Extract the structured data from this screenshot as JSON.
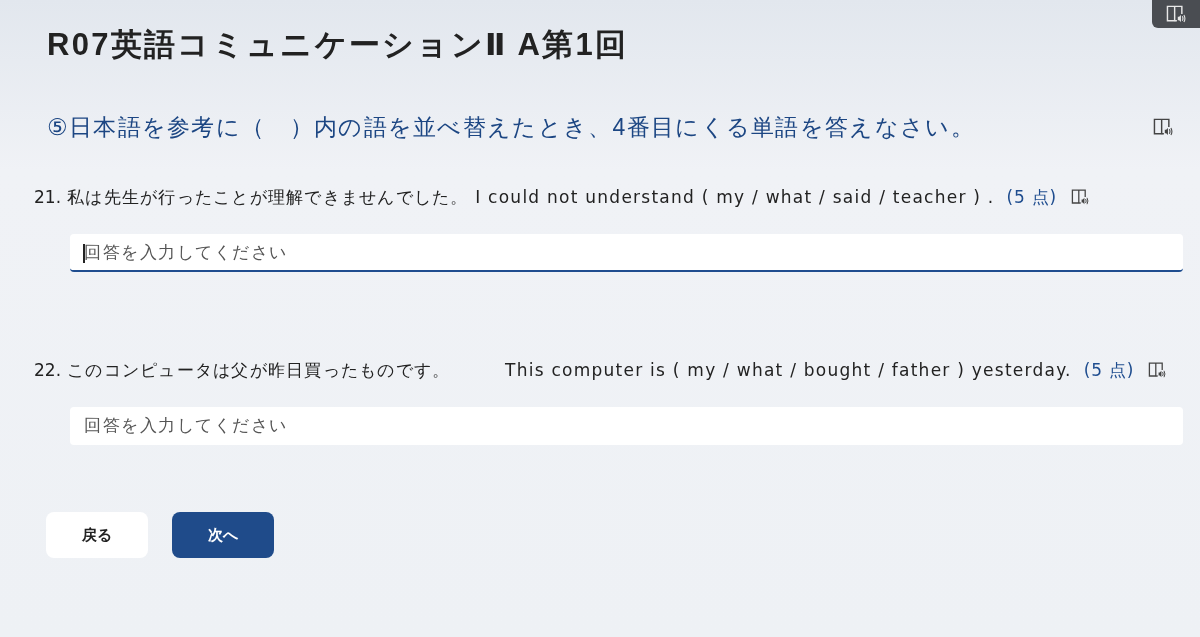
{
  "title": "R07英語コミュニケーションⅡ A第1回",
  "instruction": {
    "text": "⑤日本語を参考に（　）内の語を並べ替えたとき、4番目にくる単語を答えなさい。"
  },
  "questions": [
    {
      "number": "21.",
      "sentence": "私は先生が行ったことが理解できませんでした。 I could not understand ( my / what / said / teacher ) .",
      "points": "(5 点)",
      "answer": {
        "placeholder": "回答を入力してください",
        "focused": true
      }
    },
    {
      "number": "22.",
      "sentence": "このコンピュータは父が昨日買ったものです。　　　This computer is ( my / what / bought / father ) yesterday.",
      "points": "(5 点)",
      "answer": {
        "placeholder": "回答を入力してください",
        "focused": false
      }
    }
  ],
  "buttons": [
    {
      "label": "戻る",
      "kind": "secondary"
    },
    {
      "label": "次へ",
      "kind": "primary"
    }
  ]
}
